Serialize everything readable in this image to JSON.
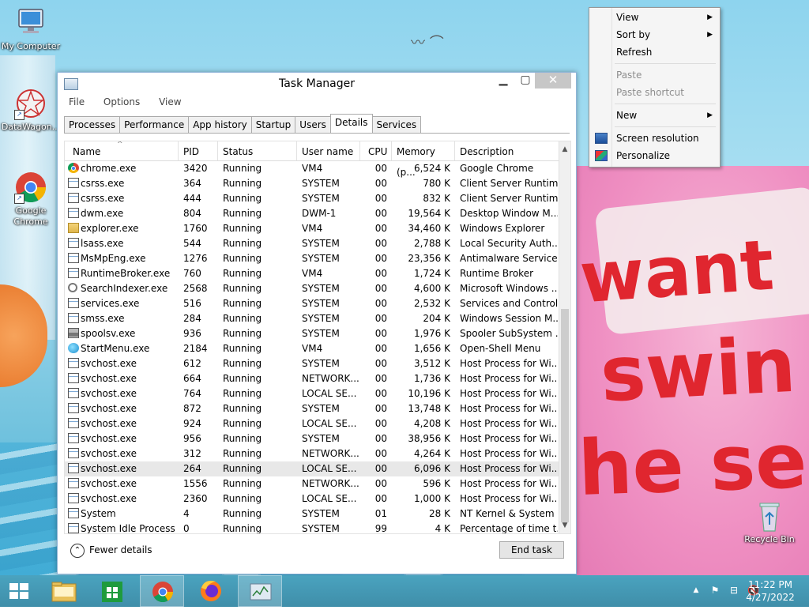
{
  "desktop": {
    "icons": [
      {
        "label": "My Computer"
      },
      {
        "label": "DataWagon..."
      },
      {
        "label": "Google Chrome"
      },
      {
        "label": "Recycle Bin"
      }
    ]
  },
  "task_manager": {
    "title": "Task Manager",
    "menu": [
      "File",
      "Options",
      "View"
    ],
    "tabs": [
      "Processes",
      "Performance",
      "App history",
      "Startup",
      "Users",
      "Details",
      "Services"
    ],
    "active_tab": "Details",
    "columns": [
      "Name",
      "PID",
      "Status",
      "User name",
      "CPU",
      "Memory (p...",
      "Description"
    ],
    "rows": [
      {
        "name": "chrome.exe",
        "pid": "3420",
        "status": "Running",
        "user": "VM4",
        "cpu": "00",
        "mem": "6,524 K",
        "desc": "Google Chrome",
        "icon": "chrome-icon"
      },
      {
        "name": "csrss.exe",
        "pid": "364",
        "status": "Running",
        "user": "SYSTEM",
        "cpu": "00",
        "mem": "780 K",
        "desc": "Client Server Runtim...",
        "icon": "app-icon"
      },
      {
        "name": "csrss.exe",
        "pid": "444",
        "status": "Running",
        "user": "SYSTEM",
        "cpu": "00",
        "mem": "832 K",
        "desc": "Client Server Runtim...",
        "icon": "app-icon"
      },
      {
        "name": "dwm.exe",
        "pid": "804",
        "status": "Running",
        "user": "DWM-1",
        "cpu": "00",
        "mem": "19,564 K",
        "desc": "Desktop Window M...",
        "icon": "app-icon"
      },
      {
        "name": "explorer.exe",
        "pid": "1760",
        "status": "Running",
        "user": "VM4",
        "cpu": "00",
        "mem": "34,460 K",
        "desc": "Windows Explorer",
        "icon": "folder-icon"
      },
      {
        "name": "lsass.exe",
        "pid": "544",
        "status": "Running",
        "user": "SYSTEM",
        "cpu": "00",
        "mem": "2,788 K",
        "desc": "Local Security Auth...",
        "icon": "app-icon"
      },
      {
        "name": "MsMpEng.exe",
        "pid": "1276",
        "status": "Running",
        "user": "SYSTEM",
        "cpu": "00",
        "mem": "23,356 K",
        "desc": "Antimalware Service...",
        "icon": "app-icon"
      },
      {
        "name": "RuntimeBroker.exe",
        "pid": "760",
        "status": "Running",
        "user": "VM4",
        "cpu": "00",
        "mem": "1,724 K",
        "desc": "Runtime Broker",
        "icon": "app-icon"
      },
      {
        "name": "SearchIndexer.exe",
        "pid": "2568",
        "status": "Running",
        "user": "SYSTEM",
        "cpu": "00",
        "mem": "4,600 K",
        "desc": "Microsoft Windows ...",
        "icon": "search-icon"
      },
      {
        "name": "services.exe",
        "pid": "516",
        "status": "Running",
        "user": "SYSTEM",
        "cpu": "00",
        "mem": "2,532 K",
        "desc": "Services and Control...",
        "icon": "app-icon"
      },
      {
        "name": "smss.exe",
        "pid": "284",
        "status": "Running",
        "user": "SYSTEM",
        "cpu": "00",
        "mem": "204 K",
        "desc": "Windows Session M...",
        "icon": "app-icon"
      },
      {
        "name": "spoolsv.exe",
        "pid": "936",
        "status": "Running",
        "user": "SYSTEM",
        "cpu": "00",
        "mem": "1,976 K",
        "desc": "Spooler SubSystem ...",
        "icon": "printer-icon"
      },
      {
        "name": "StartMenu.exe",
        "pid": "2184",
        "status": "Running",
        "user": "VM4",
        "cpu": "00",
        "mem": "1,656 K",
        "desc": "Open-Shell Menu",
        "icon": "start-menu-icon"
      },
      {
        "name": "svchost.exe",
        "pid": "612",
        "status": "Running",
        "user": "SYSTEM",
        "cpu": "00",
        "mem": "3,512 K",
        "desc": "Host Process for Wi...",
        "icon": "app-icon"
      },
      {
        "name": "svchost.exe",
        "pid": "664",
        "status": "Running",
        "user": "NETWORK...",
        "cpu": "00",
        "mem": "1,736 K",
        "desc": "Host Process for Wi...",
        "icon": "app-icon"
      },
      {
        "name": "svchost.exe",
        "pid": "764",
        "status": "Running",
        "user": "LOCAL SE...",
        "cpu": "00",
        "mem": "10,196 K",
        "desc": "Host Process for Wi...",
        "icon": "app-icon"
      },
      {
        "name": "svchost.exe",
        "pid": "872",
        "status": "Running",
        "user": "SYSTEM",
        "cpu": "00",
        "mem": "13,748 K",
        "desc": "Host Process for Wi...",
        "icon": "app-icon"
      },
      {
        "name": "svchost.exe",
        "pid": "924",
        "status": "Running",
        "user": "LOCAL SE...",
        "cpu": "00",
        "mem": "4,208 K",
        "desc": "Host Process for Wi...",
        "icon": "app-icon"
      },
      {
        "name": "svchost.exe",
        "pid": "956",
        "status": "Running",
        "user": "SYSTEM",
        "cpu": "00",
        "mem": "38,956 K",
        "desc": "Host Process for Wi...",
        "icon": "app-icon"
      },
      {
        "name": "svchost.exe",
        "pid": "312",
        "status": "Running",
        "user": "NETWORK...",
        "cpu": "00",
        "mem": "4,264 K",
        "desc": "Host Process for Wi...",
        "icon": "app-icon"
      },
      {
        "name": "svchost.exe",
        "pid": "264",
        "status": "Running",
        "user": "LOCAL SE...",
        "cpu": "00",
        "mem": "6,096 K",
        "desc": "Host Process for Wi...",
        "icon": "app-icon",
        "selected": true
      },
      {
        "name": "svchost.exe",
        "pid": "1556",
        "status": "Running",
        "user": "NETWORK...",
        "cpu": "00",
        "mem": "596 K",
        "desc": "Host Process for Wi...",
        "icon": "app-icon"
      },
      {
        "name": "svchost.exe",
        "pid": "2360",
        "status": "Running",
        "user": "LOCAL SE...",
        "cpu": "00",
        "mem": "1,000 K",
        "desc": "Host Process for Wi...",
        "icon": "app-icon"
      },
      {
        "name": "System",
        "pid": "4",
        "status": "Running",
        "user": "SYSTEM",
        "cpu": "01",
        "mem": "28 K",
        "desc": "NT Kernel & System",
        "icon": "app-icon"
      },
      {
        "name": "System Idle Process",
        "pid": "0",
        "status": "Running",
        "user": "SYSTEM",
        "cpu": "99",
        "mem": "4 K",
        "desc": "Percentage of time t...",
        "icon": "app-icon"
      }
    ],
    "fewer_details": "Fewer details",
    "end_task": "End task"
  },
  "context_menu": {
    "items": [
      {
        "label": "View",
        "submenu": true,
        "disabled": false
      },
      {
        "label": "Sort by",
        "submenu": true,
        "disabled": false
      },
      {
        "label": "Refresh",
        "submenu": false,
        "disabled": false
      },
      {
        "label": "Paste",
        "submenu": false,
        "disabled": true
      },
      {
        "label": "Paste shortcut",
        "submenu": false,
        "disabled": true
      },
      {
        "label": "New",
        "submenu": true,
        "disabled": false
      },
      {
        "label": "Screen resolution",
        "submenu": false,
        "disabled": false,
        "icon": "display-icon"
      },
      {
        "label": "Personalize",
        "submenu": false,
        "disabled": false,
        "icon": "personalize-icon"
      }
    ]
  },
  "taskbar": {
    "clock_time": "11:22 PM",
    "clock_date": "4/27/2022"
  },
  "colors": {
    "taskbar": "#4298b5",
    "selection": "#e8e8e8",
    "wallpaper_text": "#e0262f"
  }
}
